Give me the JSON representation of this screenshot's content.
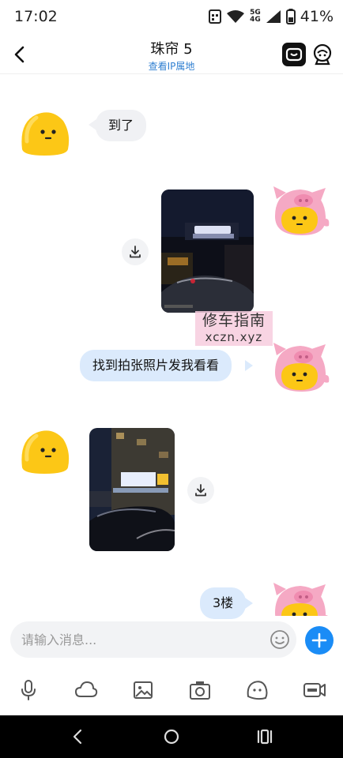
{
  "status_bar": {
    "time": "17:02",
    "network_top": "5G",
    "network_bottom": "4G",
    "battery": "41%"
  },
  "header": {
    "title": "珠帘 5",
    "subtitle_link": "查看IP属地"
  },
  "messages": [
    {
      "side": "left",
      "type": "text",
      "text": "到了"
    },
    {
      "side": "right",
      "type": "image",
      "image_desc_label": "dark street photo with sign"
    },
    {
      "side": "right",
      "type": "text",
      "text": "找到拍张照片发我看看"
    },
    {
      "side": "left",
      "type": "image",
      "image_desc_label": "night building photo with cars"
    },
    {
      "side": "right",
      "type": "text",
      "text": "3楼"
    }
  ],
  "watermark": {
    "line1": "修车指南",
    "line2": "xczn.xyz"
  },
  "composer": {
    "placeholder": "请输入消息..."
  },
  "toolbar_icons": [
    "microphone-icon",
    "cloud-icon",
    "image-icon",
    "camera-icon",
    "emoji-icon",
    "gif-icon"
  ],
  "navbar_icons": [
    "back-icon",
    "home-icon",
    "recents-icon"
  ],
  "colors": {
    "accent": "#1a8cf6",
    "link": "#2f7fd1",
    "bubble_right": "#dbeafc",
    "bubble_left": "#f0f1f4"
  }
}
